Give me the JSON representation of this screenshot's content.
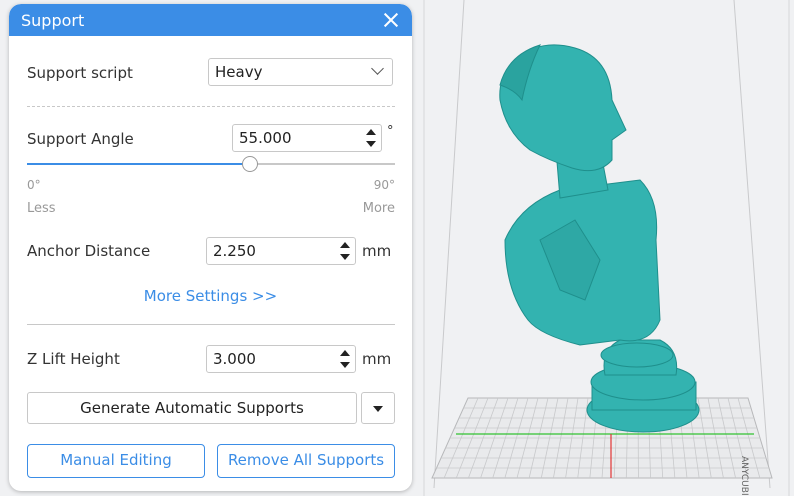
{
  "panel": {
    "title": "Support",
    "support_script": {
      "label": "Support script",
      "value": "Heavy"
    },
    "support_angle": {
      "label": "Support Angle",
      "value": "55.000",
      "unit": "°",
      "slider": {
        "min_label": "0°",
        "max_label": "90°",
        "min_caption": "Less",
        "max_caption": "More",
        "value": 55
      }
    },
    "anchor_distance": {
      "label": "Anchor Distance",
      "value": "2.250",
      "unit": "mm"
    },
    "more_settings": "More Settings >>",
    "z_lift": {
      "label": "Z Lift Height",
      "value": "3.000",
      "unit": "mm"
    },
    "generate_button": "Generate Automatic Supports",
    "manual_button": "Manual Editing",
    "remove_button": "Remove All Supports"
  },
  "viewport": {
    "model_color": "#33b3b0",
    "plate_label": "ANYCUBIC"
  },
  "colors": {
    "accent": "#3b8de6"
  }
}
